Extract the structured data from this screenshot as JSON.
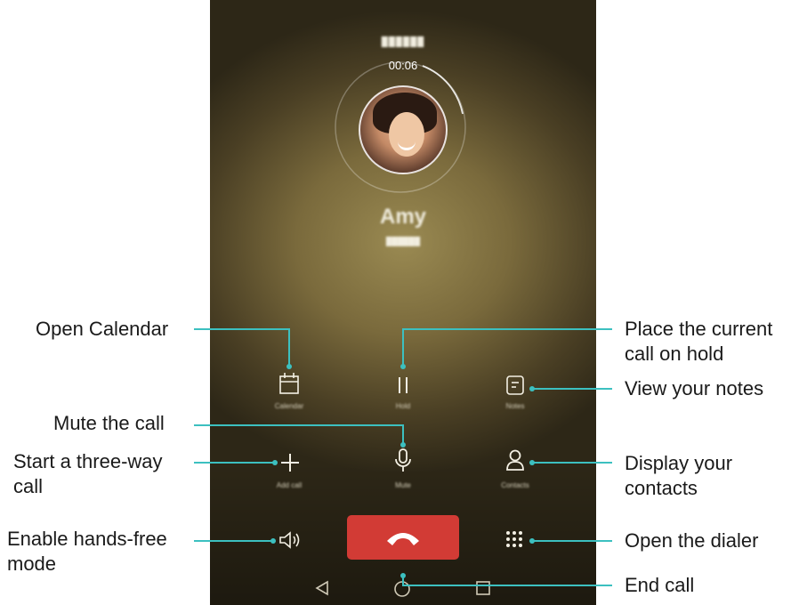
{
  "call": {
    "timer": "00:06",
    "number_blurred": "██████",
    "contact_name": "Amy",
    "contact_sub": "██████"
  },
  "buttons": {
    "calendar_label": "Calendar",
    "hold_label": "Hold",
    "notes_label": "Notes",
    "add_call_label": "Add call",
    "mute_label": "Mute",
    "contacts_label": "Contacts"
  },
  "callouts": {
    "open_calendar": "Open Calendar",
    "place_hold_1": "Place the current",
    "place_hold_2": "call on hold",
    "view_notes": "View your notes",
    "mute_call": "Mute the call",
    "three_way_1": "Start a three-way",
    "three_way_2": "call",
    "contacts_1": "Display your",
    "contacts_2": "contacts",
    "hands_free_1": "Enable hands-free",
    "hands_free_2": "mode",
    "open_dialer": "Open the dialer",
    "end_call": "End call"
  },
  "icons": {
    "calendar": "calendar-icon",
    "hold": "pause-icon",
    "notes": "notes-icon",
    "add": "plus-icon",
    "mute": "microphone-icon",
    "contacts": "person-icon",
    "speaker": "speaker-icon",
    "dialpad": "dialpad-icon",
    "end": "phone-hangup-icon",
    "back": "back-triangle-icon",
    "home": "home-circle-icon",
    "recent": "recent-square-icon"
  },
  "colors": {
    "callout_line": "#3cc0c0",
    "end_call": "#d23b35"
  }
}
